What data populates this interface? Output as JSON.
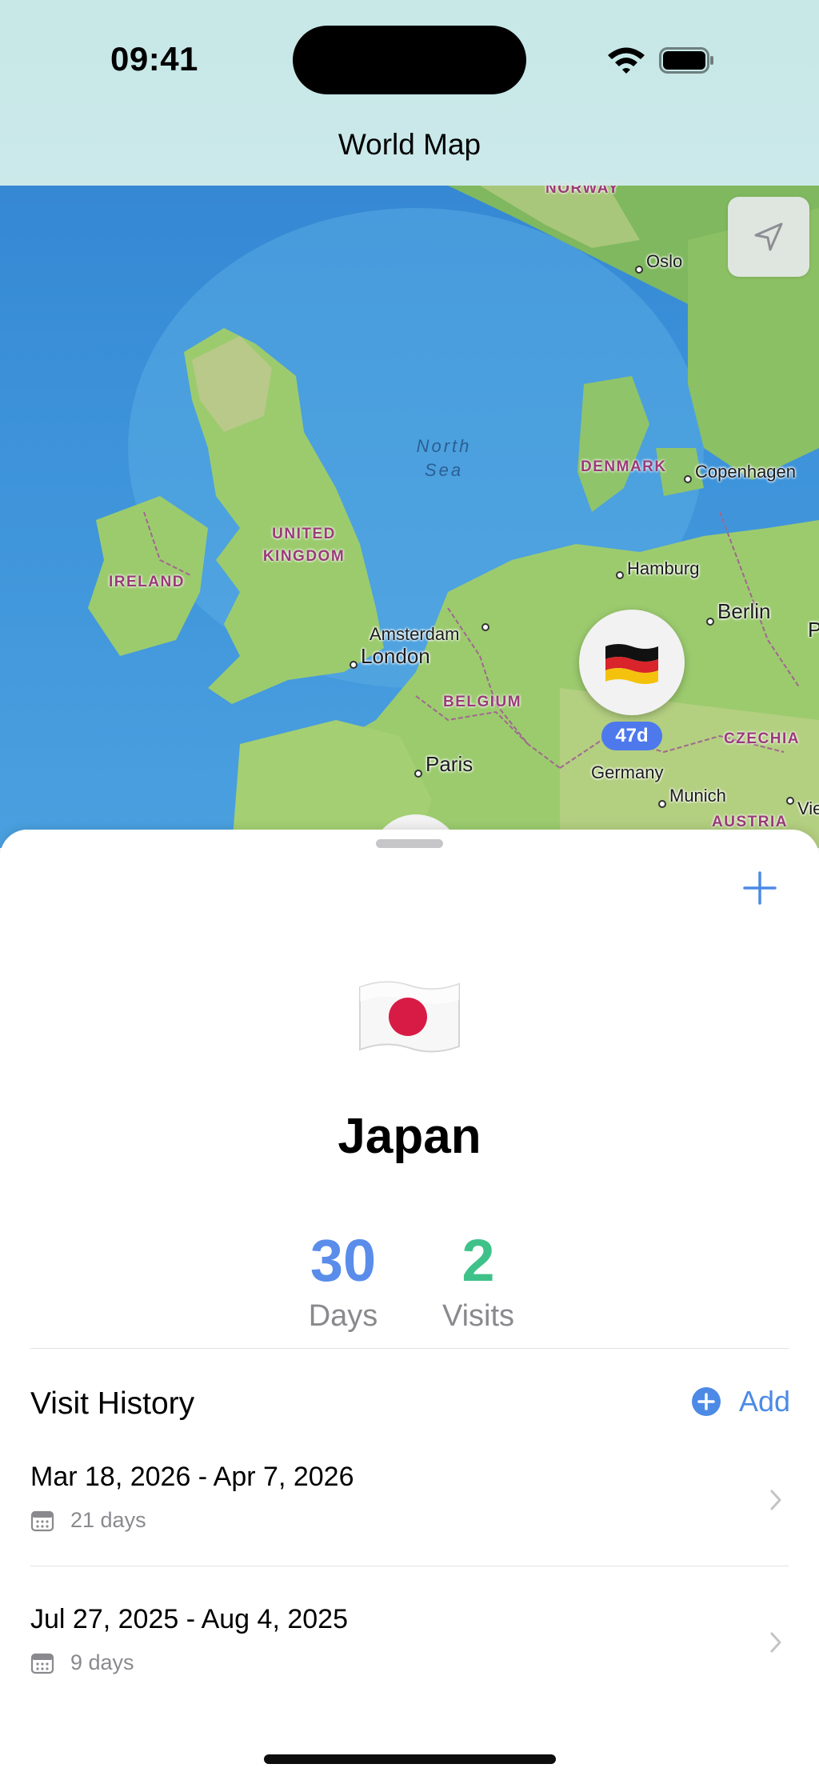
{
  "status_bar": {
    "time": "09:41"
  },
  "nav": {
    "title": "World Map"
  },
  "map": {
    "countries": {
      "norway": "NORWAY",
      "denmark": "DENMARK",
      "uk_line1": "UNITED",
      "uk_line2": "KINGDOM",
      "ireland": "IRELAND",
      "belgium": "BELGIUM",
      "czechia": "CZECHIA",
      "austria": "AUSTRIA"
    },
    "sea": {
      "line1": "North",
      "line2": "Sea"
    },
    "cities": {
      "oslo": "Oslo",
      "copenhagen": "Copenhagen",
      "hamburg": "Hamburg",
      "berlin": "Berlin",
      "amsterdam": "Amsterdam",
      "london": "London",
      "paris": "Paris",
      "munich": "Munich",
      "germany": "Germany",
      "vienna_partial": "Vie",
      "edge_partial": "P"
    },
    "marker": {
      "flag_emoji": "🇩🇪",
      "badge": "47d"
    }
  },
  "sheet": {
    "flag_emoji": "🇯🇵",
    "country": "Japan",
    "stats": {
      "days_value": "30",
      "days_label": "Days",
      "visits_value": "2",
      "visits_label": "Visits"
    },
    "history_title": "Visit History",
    "add_label": "Add",
    "visits": [
      {
        "dates": "Mar 18, 2026 - Apr 7, 2026",
        "duration": "21 days"
      },
      {
        "dates": "Jul 27, 2025 - Aug 4, 2025",
        "duration": "9 days"
      }
    ]
  },
  "colors": {
    "accent_blue": "#4c8ae6",
    "days_blue": "#5a8dea",
    "visits_green": "#3fc28a",
    "badge_blue": "#4d79ec"
  }
}
